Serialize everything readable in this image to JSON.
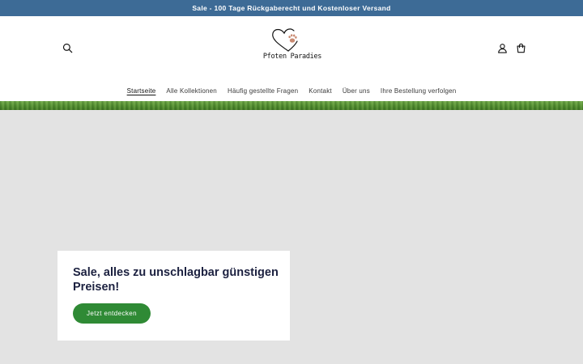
{
  "announcement": {
    "text": "Sale - 100 Tage Rückgaberecht und Kostenloser Versand"
  },
  "header": {
    "logo_text": "Pfoten Paradies",
    "icons": {
      "search": "search-icon",
      "account": "user-icon",
      "cart": "cart-icon"
    }
  },
  "nav": {
    "items": [
      {
        "label": "Startseite",
        "active": true
      },
      {
        "label": "Alle Kollektionen",
        "active": false
      },
      {
        "label": "Häufig gestellte Fragen",
        "active": false
      },
      {
        "label": "Kontakt",
        "active": false
      },
      {
        "label": "Über uns",
        "active": false
      },
      {
        "label": "Ihre Bestellung verfolgen",
        "active": false
      }
    ]
  },
  "hero": {
    "heading": "Sale, alles zu unschlagbar günstigen Preisen!",
    "button_label": "Jetzt entdecken"
  },
  "colors": {
    "announcement_bg": "#3d6b96",
    "hero_bg": "#e3e3e3",
    "heading": "#1c2140",
    "button_bg": "#2f8a35"
  }
}
